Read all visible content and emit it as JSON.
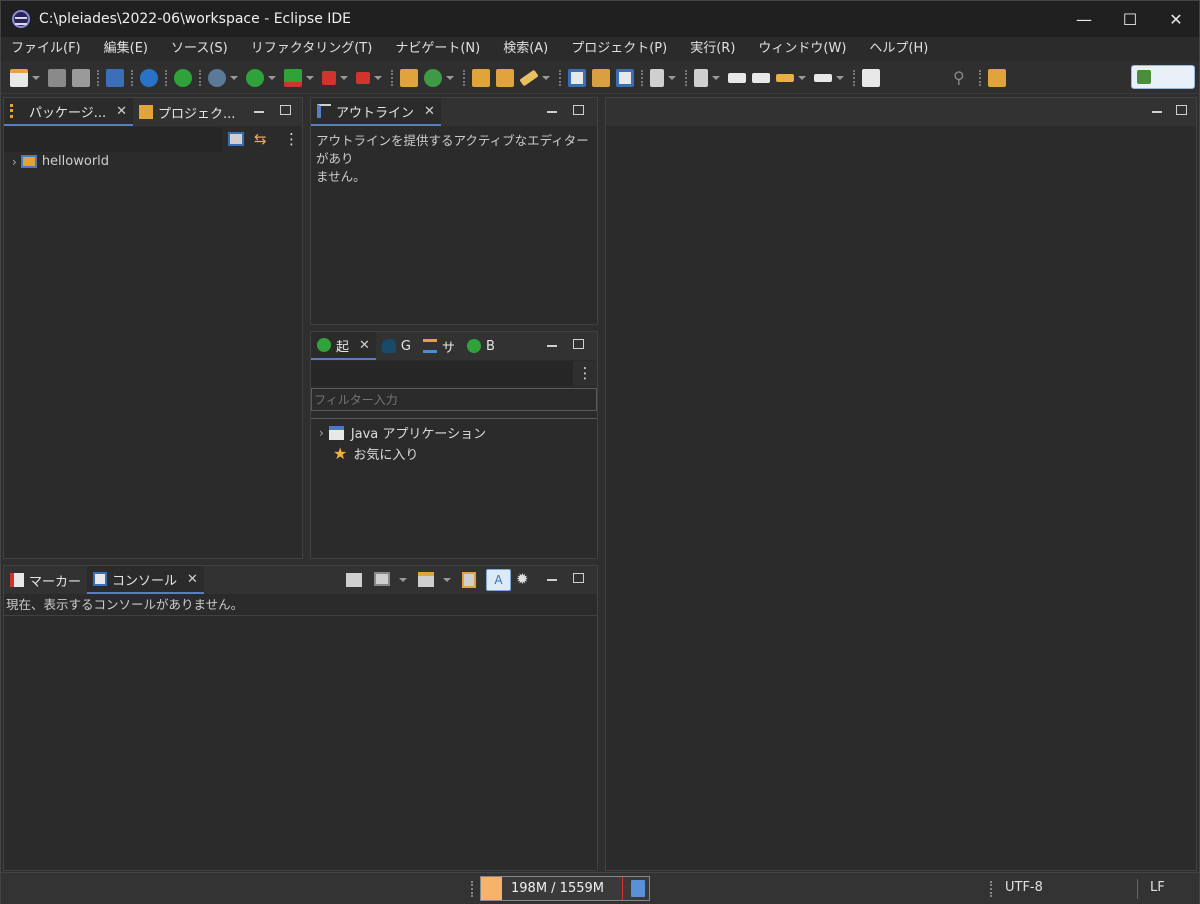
{
  "window": {
    "title": "C:\\pleiades\\2022-06\\workspace - Eclipse IDE",
    "minimize_glyph": "—",
    "maximize_glyph": "☐",
    "close_glyph": "✕"
  },
  "menu": [
    "ファイル(F)",
    "編集(E)",
    "ソース(S)",
    "リファクタリング(T)",
    "ナビゲート(N)",
    "検索(A)",
    "プロジェクト(P)",
    "実行(R)",
    "ウィンドウ(W)",
    "ヘルプ(H)"
  ],
  "package_panel": {
    "tabs": [
      {
        "label": "パッケージ...",
        "icon": "package-explorer-icon"
      },
      {
        "label": "プロジェク...",
        "icon": "project-explorer-icon"
      }
    ],
    "tree": [
      {
        "label": "helloworld",
        "icon": "java-project-icon"
      }
    ]
  },
  "outline_panel": {
    "tab_label": "アウトライン",
    "message_line1": "アウトラインを提供するアクティブなエディターがあり",
    "message_line2": "ません。"
  },
  "launch_panel": {
    "tabs": [
      {
        "label": "起",
        "icon": "run-icon"
      },
      {
        "label": "G",
        "icon": "gradle-icon"
      },
      {
        "label": "サ",
        "icon": "servers-icon"
      },
      {
        "label": "B",
        "icon": "boot-dashboard-icon"
      }
    ],
    "filter_placeholder": "フィルター入力",
    "tree": [
      {
        "label": "Java アプリケーション",
        "icon": "java-app-icon"
      },
      {
        "label": "お気に入り",
        "icon": "star-icon"
      }
    ]
  },
  "console_panel": {
    "tabs": [
      {
        "label": "マーカー",
        "icon": "markers-icon"
      },
      {
        "label": "コンソール",
        "icon": "console-icon"
      }
    ],
    "message": "現在、表示するコンソールがありません。"
  },
  "status": {
    "heap_text": "198M / 1559M",
    "heap_fraction": 0.127,
    "encoding": "UTF-8",
    "line_ending": "LF"
  },
  "colors": {
    "accent_tab": "#5a7ec6",
    "heap_fill": "#f7b36a",
    "run_green": "#2fa33a",
    "stop_red": "#d0342c"
  }
}
